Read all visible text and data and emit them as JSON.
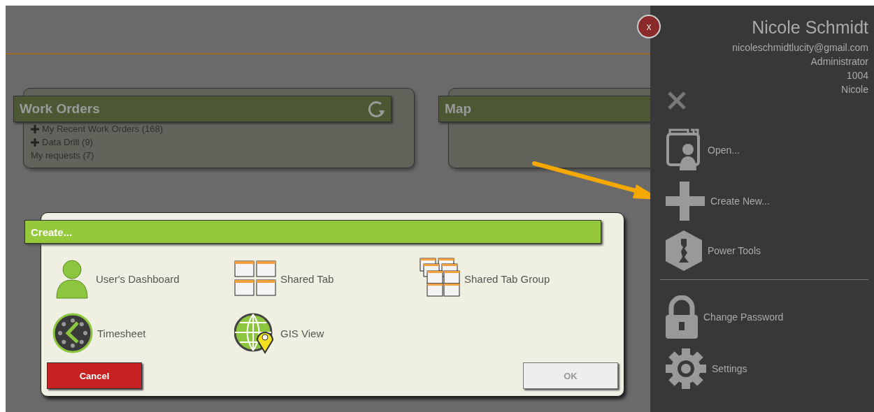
{
  "dashboard": {
    "cards": [
      {
        "title": "Work Orders",
        "refresh": true,
        "items": [
          {
            "label": "My Recent Work Orders (168)",
            "expandable": true
          },
          {
            "label": "Data Drill (9)",
            "expandable": true
          },
          {
            "label": "My requests (7)",
            "expandable": false
          }
        ]
      },
      {
        "title": "Map"
      }
    ]
  },
  "dialog": {
    "title": "Create...",
    "options": [
      {
        "label": "User's Dashboard",
        "kind": "dashboard"
      },
      {
        "label": "Shared Tab",
        "kind": "tab"
      },
      {
        "label": "Shared Tab Group",
        "kind": "tabgroup"
      },
      {
        "label": "Timesheet",
        "kind": "timesheet"
      },
      {
        "label": "GIS View",
        "kind": "gis"
      }
    ],
    "cancel": {
      "label": "Cancel"
    },
    "ok": {
      "label": "OK",
      "disabled": true
    }
  },
  "panel": {
    "close": "x",
    "user": {
      "name": "Nicole Schmidt",
      "email": "nicoleschmidtlucity@gmail.com",
      "role": "Administrator",
      "number": "1004",
      "nickname": "Nicole"
    },
    "groups": [
      [
        {
          "label": "Open...",
          "kind": "open"
        },
        {
          "label": "Create New...",
          "kind": "create"
        },
        {
          "label": "Power Tools",
          "kind": "tools"
        }
      ],
      [
        {
          "label": "Change Password",
          "kind": "password"
        },
        {
          "label": "Settings",
          "kind": "settings"
        }
      ]
    ]
  }
}
